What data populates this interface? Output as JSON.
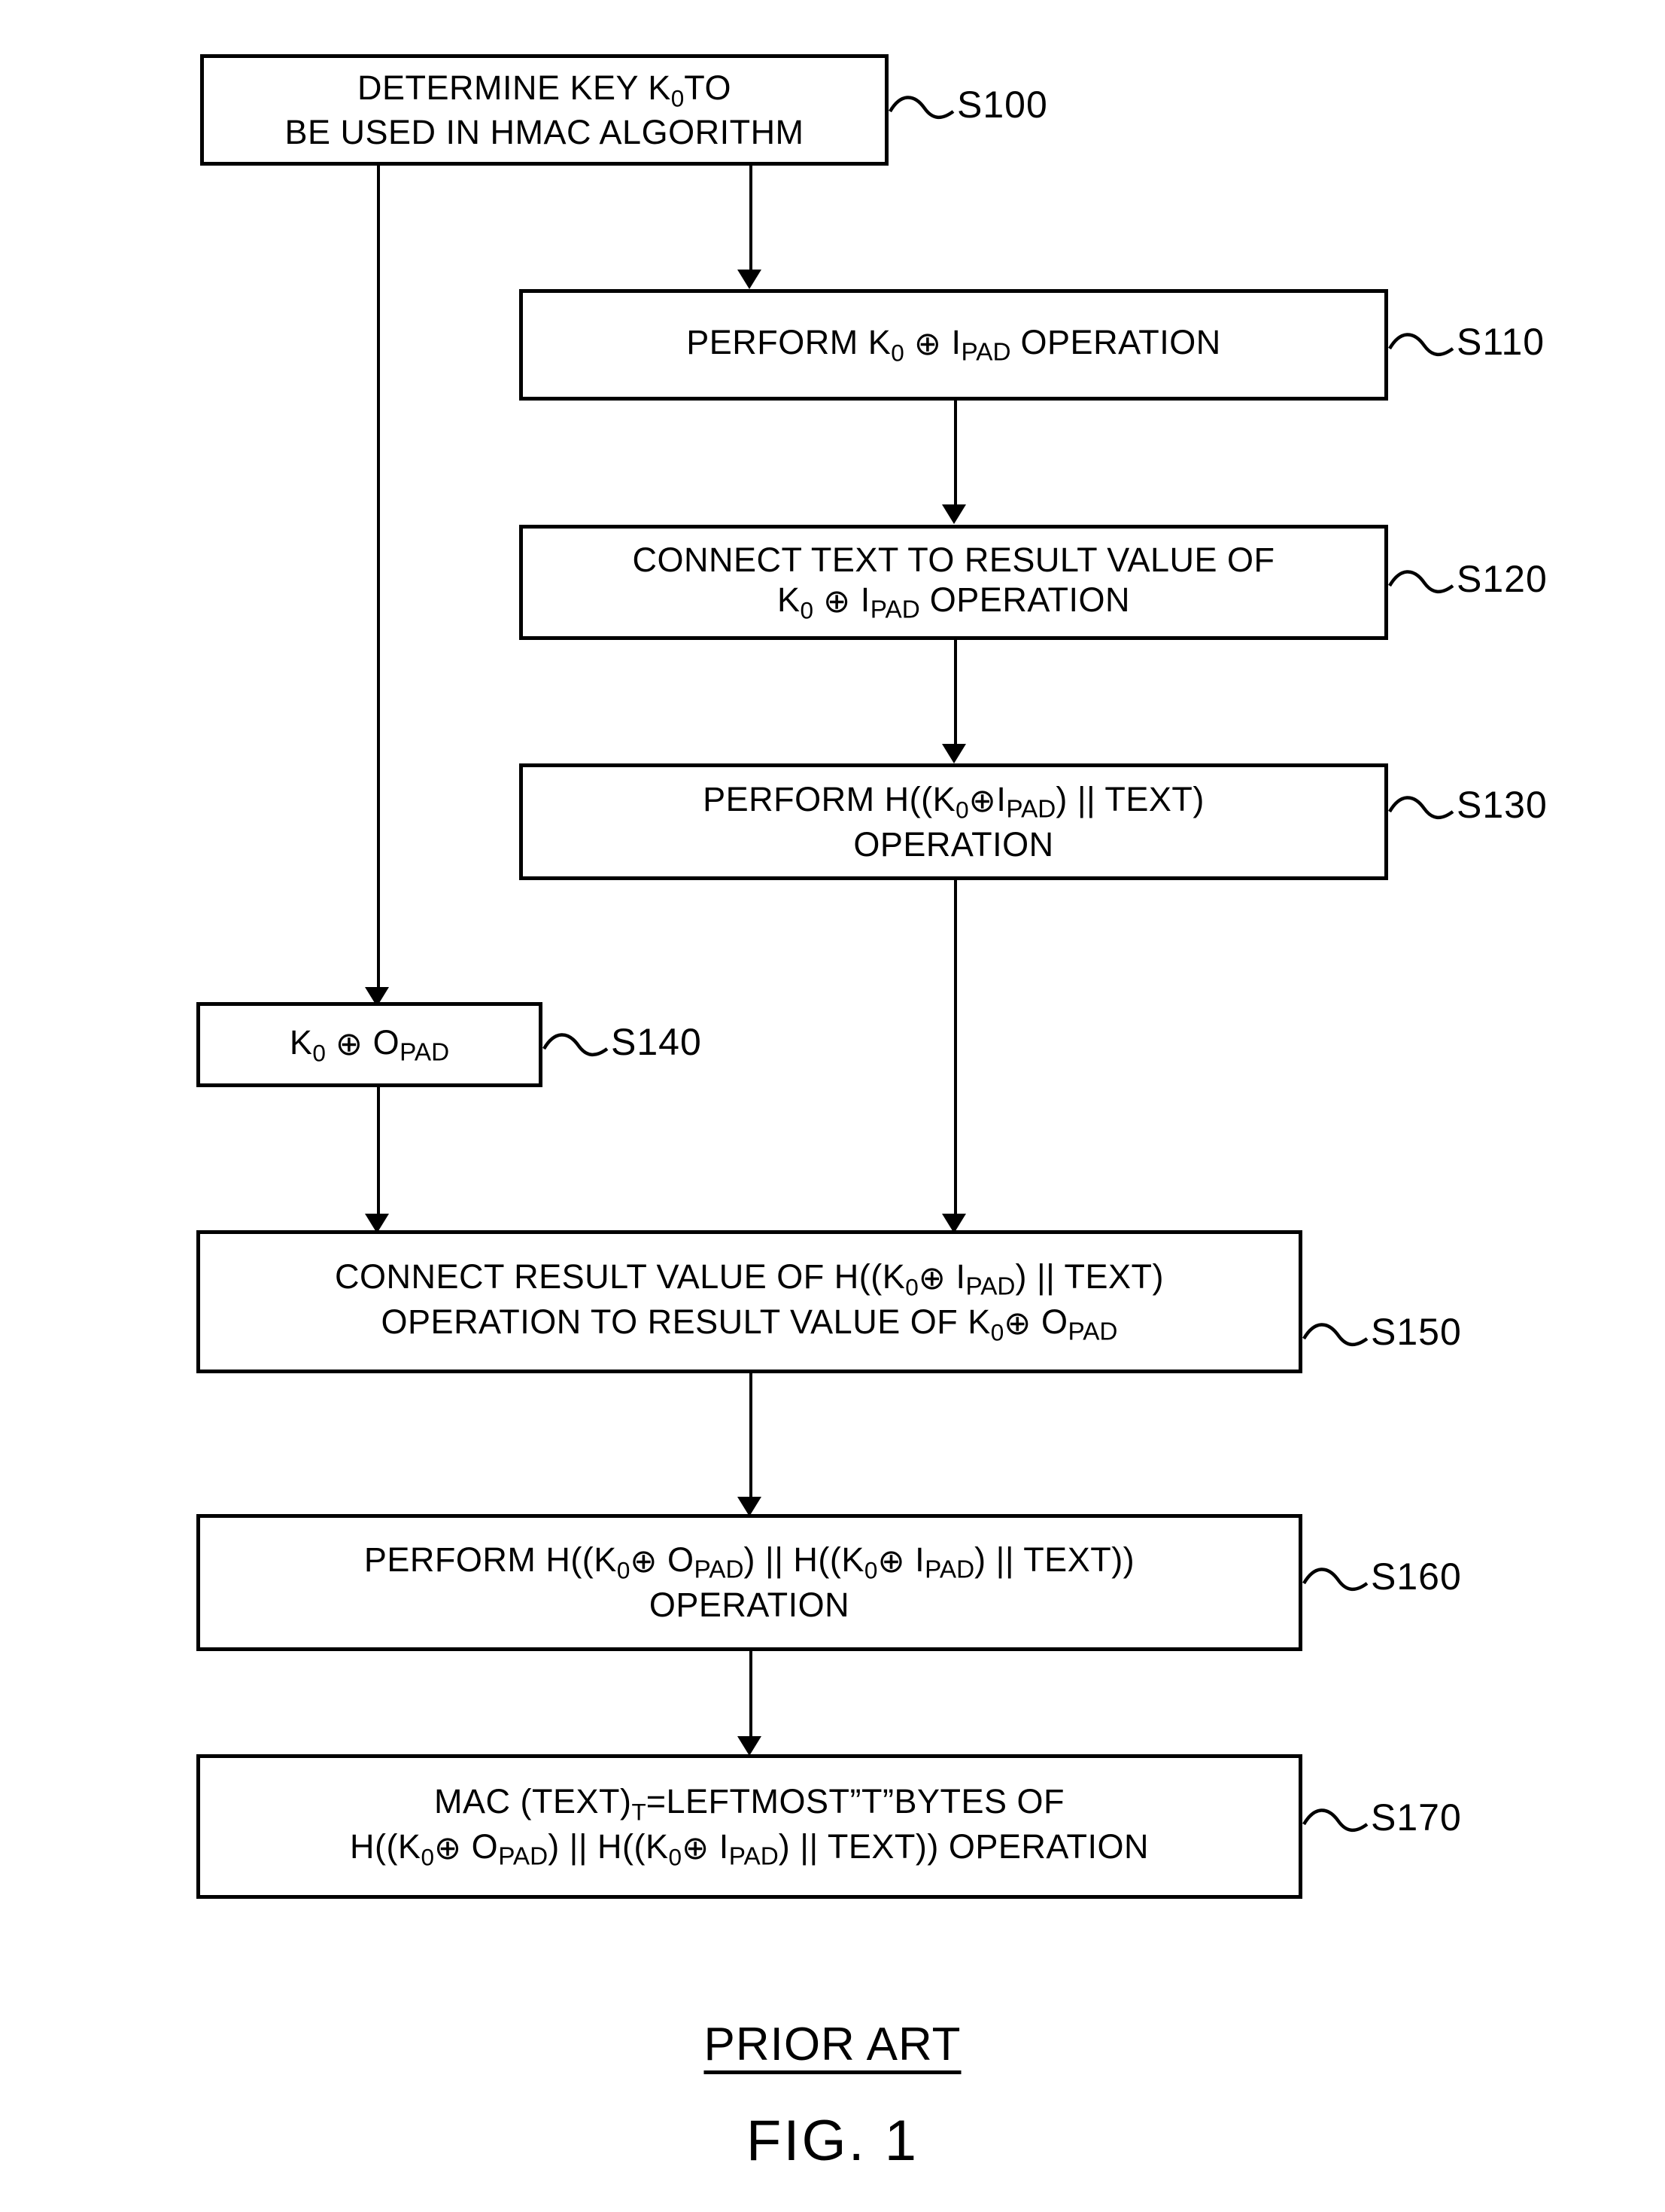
{
  "figure": {
    "prior_art_caption": "PRIOR ART",
    "figure_caption": "FIG. 1",
    "symbols": {
      "xor": "⊕",
      "concat": "||",
      "key": "K",
      "key_subscript": "0",
      "ipad_main": "I",
      "ipad_sub": "PAD",
      "opad_main": "O",
      "opad_sub": "PAD"
    }
  },
  "steps": [
    {
      "id": "S100",
      "label": "S100",
      "lines": [
        {
          "parts": [
            {
              "t": "DETERMINE KEY K"
            },
            {
              "t": "0",
              "style": "sub-num"
            },
            {
              "t": "TO"
            }
          ]
        },
        {
          "parts": [
            {
              "t": "BE USED IN HMAC ALGORITHM"
            }
          ]
        }
      ],
      "plain_text": "DETERMINE KEY K0 TO BE USED IN HMAC ALGORITHM"
    },
    {
      "id": "S110",
      "label": "S110",
      "lines": [
        {
          "parts": [
            {
              "t": "PERFORM K"
            },
            {
              "t": "0",
              "style": "sub-num"
            },
            {
              "t": " "
            },
            {
              "t": "⊕",
              "style": "xor"
            },
            {
              "t": " I"
            },
            {
              "t": "PAD",
              "style": "sub-pad"
            },
            {
              "t": " OPERATION"
            }
          ]
        }
      ],
      "plain_text": "PERFORM K0 ⊕ IPAD OPERATION"
    },
    {
      "id": "S120",
      "label": "S120",
      "lines": [
        {
          "parts": [
            {
              "t": "CONNECT TEXT TO RESULT VALUE OF"
            }
          ]
        },
        {
          "parts": [
            {
              "t": "K"
            },
            {
              "t": "0",
              "style": "sub-num"
            },
            {
              "t": " "
            },
            {
              "t": "⊕",
              "style": "xor"
            },
            {
              "t": " I"
            },
            {
              "t": "PAD",
              "style": "sub-pad"
            },
            {
              "t": " OPERATION"
            }
          ]
        }
      ],
      "plain_text": "CONNECT TEXT TO RESULT VALUE OF K0 ⊕ IPAD OPERATION"
    },
    {
      "id": "S130",
      "label": "S130",
      "lines": [
        {
          "parts": [
            {
              "t": "PERFORM H((K"
            },
            {
              "t": "0",
              "style": "sub-num"
            },
            {
              "t": "⊕",
              "style": "xor"
            },
            {
              "t": "I"
            },
            {
              "t": "PAD",
              "style": "sub-pad"
            },
            {
              "t": ") || TEXT)"
            }
          ]
        },
        {
          "parts": [
            {
              "t": "OPERATION"
            }
          ]
        }
      ],
      "plain_text": "PERFORM H((K0 ⊕ IPAD) || TEXT) OPERATION"
    },
    {
      "id": "S140",
      "label": "S140",
      "lines": [
        {
          "parts": [
            {
              "t": "K"
            },
            {
              "t": "0",
              "style": "sub-num"
            },
            {
              "t": " "
            },
            {
              "t": "⊕",
              "style": "xor"
            },
            {
              "t": " O"
            },
            {
              "t": "PAD",
              "style": "sub-pad"
            }
          ]
        }
      ],
      "plain_text": "K0 ⊕ OPAD"
    },
    {
      "id": "S150",
      "label": "S150",
      "lines": [
        {
          "parts": [
            {
              "t": "CONNECT RESULT VALUE OF H((K"
            },
            {
              "t": "0",
              "style": "sub-num"
            },
            {
              "t": "⊕",
              "style": "xor"
            },
            {
              "t": " I"
            },
            {
              "t": "PAD",
              "style": "sub-pad"
            },
            {
              "t": ") || TEXT)"
            }
          ]
        },
        {
          "parts": [
            {
              "t": "OPERATION TO RESULT VALUE OF K"
            },
            {
              "t": "0",
              "style": "sub-num"
            },
            {
              "t": "⊕",
              "style": "xor"
            },
            {
              "t": " O"
            },
            {
              "t": "PAD",
              "style": "sub-pad"
            }
          ]
        }
      ],
      "plain_text": "CONNECT RESULT VALUE OF H((K0 ⊕ IPAD) || TEXT) OPERATION TO RESULT VALUE OF K0 ⊕ OPAD"
    },
    {
      "id": "S160",
      "label": "S160",
      "lines": [
        {
          "parts": [
            {
              "t": "PERFORM H((K"
            },
            {
              "t": "0",
              "style": "sub-num"
            },
            {
              "t": "⊕",
              "style": "xor"
            },
            {
              "t": " O"
            },
            {
              "t": "PAD",
              "style": "sub-pad"
            },
            {
              "t": ") || H((K"
            },
            {
              "t": "0",
              "style": "sub-num"
            },
            {
              "t": "⊕",
              "style": "xor"
            },
            {
              "t": " I"
            },
            {
              "t": "PAD",
              "style": "sub-pad"
            },
            {
              "t": ") || TEXT))"
            }
          ]
        },
        {
          "parts": [
            {
              "t": "OPERATION"
            }
          ]
        }
      ],
      "plain_text": "PERFORM H((K0 ⊕ OPAD) || H((K0 ⊕ IPAD) || TEXT)) OPERATION"
    },
    {
      "id": "S170",
      "label": "S170",
      "lines": [
        {
          "parts": [
            {
              "t": "MAC (TEXT)"
            },
            {
              "t": "T",
              "style": "sub-num"
            },
            {
              "t": "=LEFTMOST”T”BYTES OF"
            }
          ]
        },
        {
          "parts": [
            {
              "t": "H((K"
            },
            {
              "t": "0",
              "style": "sub-num"
            },
            {
              "t": "⊕",
              "style": "xor"
            },
            {
              "t": " O"
            },
            {
              "t": "PAD",
              "style": "sub-pad"
            },
            {
              "t": ") || H((K"
            },
            {
              "t": "0",
              "style": "sub-num"
            },
            {
              "t": "⊕",
              "style": "xor"
            },
            {
              "t": " I"
            },
            {
              "t": "PAD",
              "style": "sub-pad"
            },
            {
              "t": ") || TEXT)) OPERATION"
            }
          ]
        }
      ],
      "plain_text": "MAC (TEXT)T=LEFTMOST”T”BYTES OF H((K0 ⊕ OPAD) || H((K0 ⊕ IPAD) || TEXT)) OPERATION"
    }
  ],
  "colors": {
    "ink": "#000000",
    "paper": "#ffffff"
  }
}
